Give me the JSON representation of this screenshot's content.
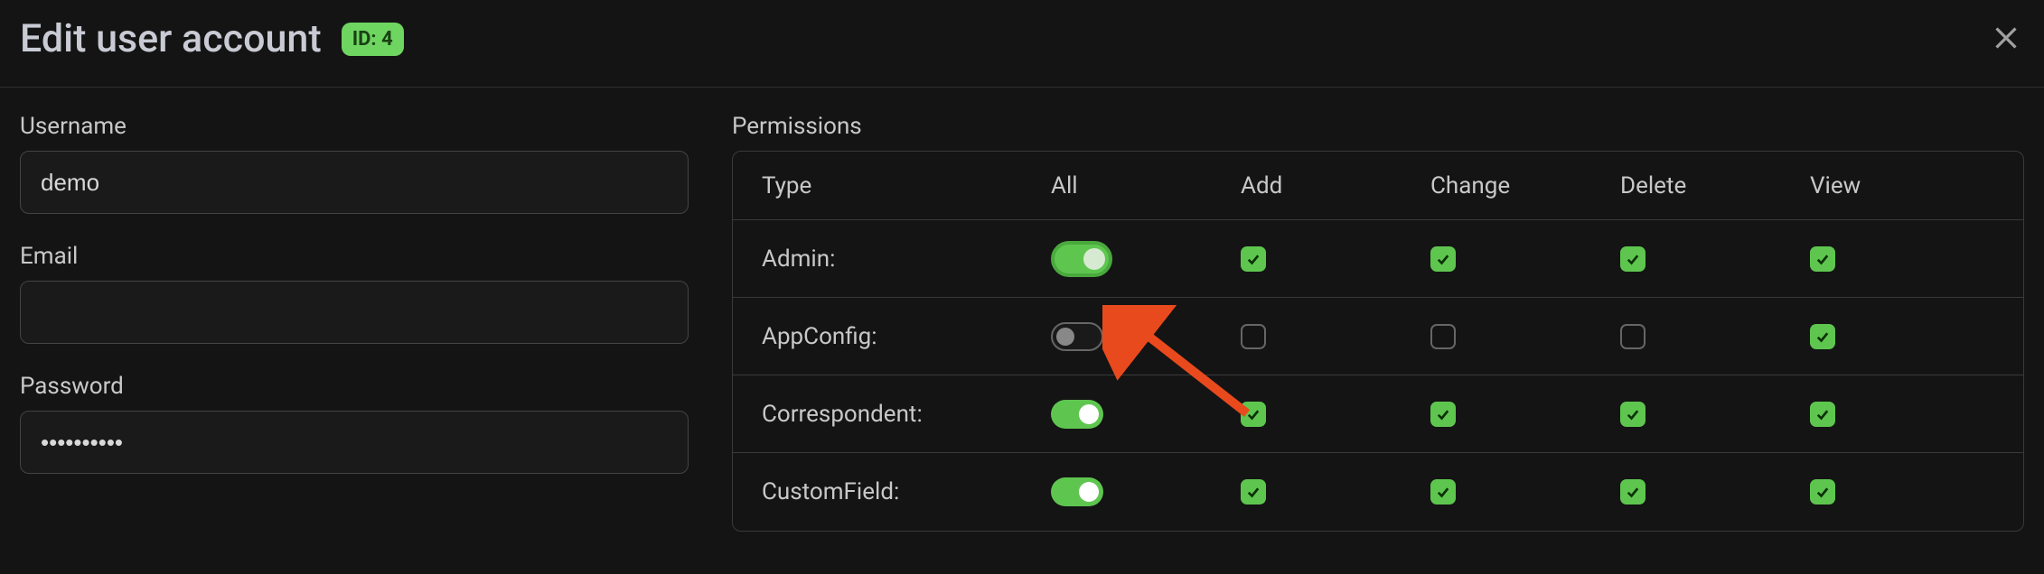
{
  "header": {
    "title": "Edit user account",
    "id_badge": "ID: 4"
  },
  "form": {
    "username_label": "Username",
    "username_value": "demo",
    "email_label": "Email",
    "email_value": "",
    "password_label": "Password",
    "password_value": "••••••••••"
  },
  "permissions": {
    "label": "Permissions",
    "columns": {
      "type": "Type",
      "all": "All",
      "add": "Add",
      "change": "Change",
      "delete": "Delete",
      "view": "View"
    },
    "rows": [
      {
        "type": "Admin:",
        "all": true,
        "add": true,
        "change": true,
        "delete": true,
        "view": true,
        "highlighted": true
      },
      {
        "type": "AppConfig:",
        "all": false,
        "add": false,
        "change": false,
        "delete": false,
        "view": true
      },
      {
        "type": "Correspondent:",
        "all": true,
        "add": true,
        "change": true,
        "delete": true,
        "view": true
      },
      {
        "type": "CustomField:",
        "all": true,
        "add": true,
        "change": true,
        "delete": true,
        "view": true
      }
    ]
  }
}
